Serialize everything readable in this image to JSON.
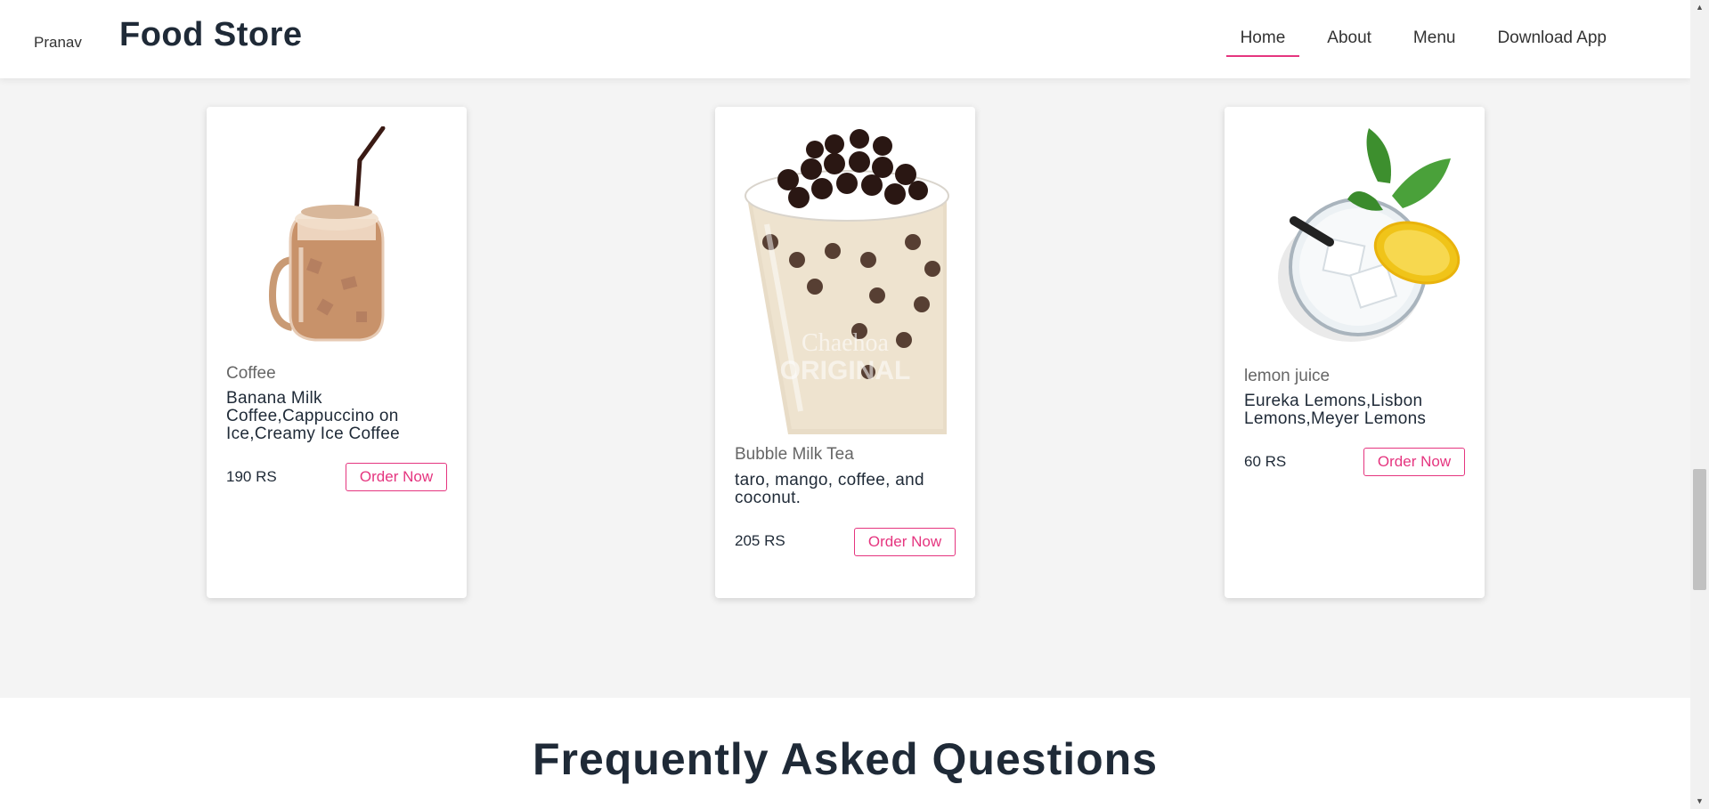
{
  "header": {
    "user": "Pranav",
    "title": "Food Store",
    "nav": [
      {
        "label": "Home",
        "active": true
      },
      {
        "label": "About",
        "active": false
      },
      {
        "label": "Menu",
        "active": false
      },
      {
        "label": "Download App",
        "active": false
      }
    ]
  },
  "products": [
    {
      "category": "Coffee",
      "description": "Banana Milk Coffee,Cappuccino on Ice,Creamy Ice Coffee",
      "price": "190 RS",
      "button": "Order Now",
      "image_icon": "iced-coffee-jar-image"
    },
    {
      "category": "Bubble Milk Tea",
      "description": "taro, mango, coffee, and coconut.",
      "price": "205 RS",
      "button": "Order Now",
      "image_icon": "bubble-tea-cup-image"
    },
    {
      "category": "lemon juice",
      "description": "Eureka Lemons,Lisbon Lemons,Meyer Lemons",
      "price": "60 RS",
      "button": "Order Now",
      "image_icon": "lemon-juice-glass-image"
    }
  ],
  "faq": {
    "title": "Frequently Asked Questions"
  },
  "colors": {
    "accent": "#e5357f",
    "text_dark": "#1f2a37",
    "section_bg": "#f4f4f4"
  }
}
